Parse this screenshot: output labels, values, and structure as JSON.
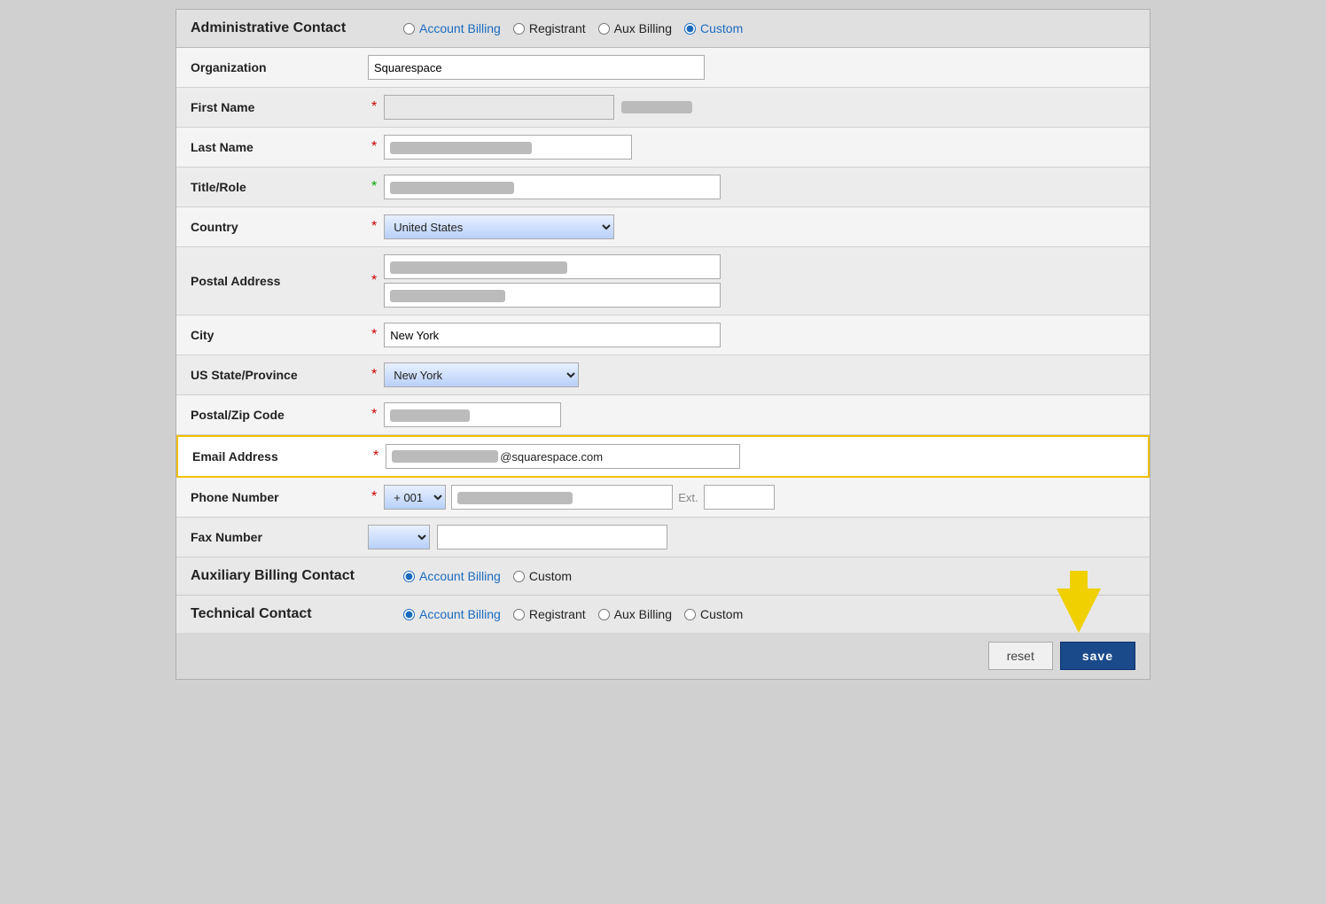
{
  "admin_contact": {
    "section_title": "Administrative Contact",
    "options": [
      {
        "label": "Account Billing",
        "value": "account_billing",
        "selected": false
      },
      {
        "label": "Registrant",
        "value": "registrant",
        "selected": false
      },
      {
        "label": "Aux Billing",
        "value": "aux_billing",
        "selected": false
      },
      {
        "label": "Custom",
        "value": "custom",
        "selected": true
      }
    ],
    "fields": {
      "organization": {
        "label": "Organization",
        "value": "Squarespace",
        "required": false
      },
      "first_name": {
        "label": "First Name",
        "required": true
      },
      "last_name": {
        "label": "Last Name",
        "required": true
      },
      "title_role": {
        "label": "Title/Role",
        "required": true,
        "required_color": "green"
      },
      "country": {
        "label": "Country",
        "value": "United States",
        "required": true
      },
      "postal_address": {
        "label": "Postal Address",
        "required": true
      },
      "city": {
        "label": "City",
        "value": "New York",
        "required": true
      },
      "us_state": {
        "label": "US State/Province",
        "value": "New York",
        "required": true
      },
      "postal_zip": {
        "label": "Postal/Zip Code",
        "required": true
      },
      "email_address": {
        "label": "Email Address",
        "value": "@squarespace.com",
        "required": true,
        "highlighted": true
      },
      "phone_number": {
        "label": "Phone Number",
        "required": true,
        "country_code": "+ 001",
        "ext_label": "Ext."
      },
      "fax_number": {
        "label": "Fax Number",
        "required": false
      }
    }
  },
  "aux_billing": {
    "section_title": "Auxiliary Billing Contact",
    "options": [
      {
        "label": "Account Billing",
        "value": "account_billing",
        "selected": true
      },
      {
        "label": "Custom",
        "value": "custom",
        "selected": false
      }
    ]
  },
  "tech_contact": {
    "section_title": "Technical Contact",
    "options": [
      {
        "label": "Account Billing",
        "value": "account_billing",
        "selected": true
      },
      {
        "label": "Registrant",
        "value": "registrant",
        "selected": false
      },
      {
        "label": "Aux Billing",
        "value": "aux_billing",
        "selected": false
      },
      {
        "label": "Custom",
        "value": "custom",
        "selected": false
      }
    ]
  },
  "actions": {
    "reset_label": "reset",
    "save_label": "save"
  }
}
